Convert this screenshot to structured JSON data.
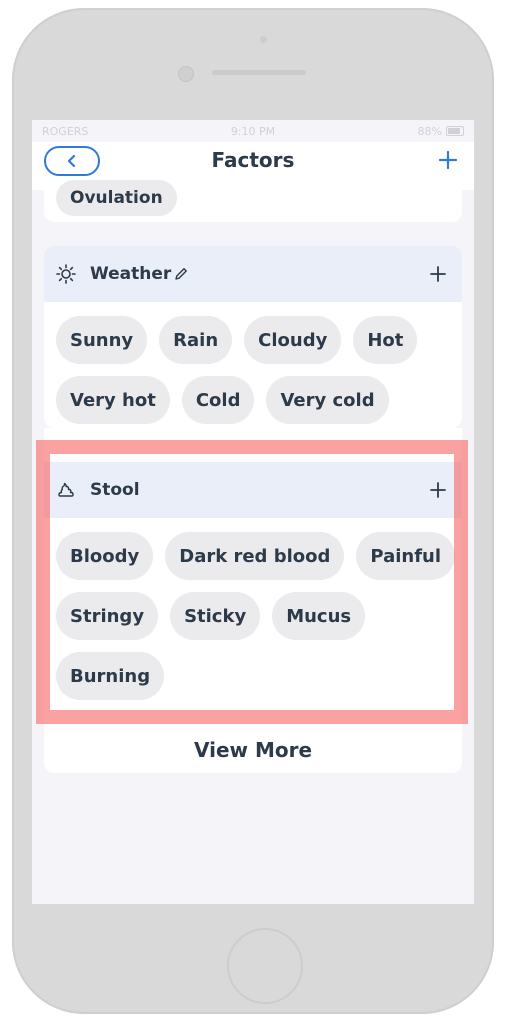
{
  "status_bar": {
    "carrier": "ROGERS",
    "time": "9:10 PM",
    "battery": "88%"
  },
  "nav": {
    "title": "Factors"
  },
  "previous_section": {
    "chip": "Ovulation"
  },
  "weather": {
    "title": "Weather",
    "chips": [
      "Sunny",
      "Rain",
      "Cloudy",
      "Hot",
      "Very hot",
      "Cold",
      "Very cold"
    ]
  },
  "stool": {
    "title": "Stool",
    "chips": [
      "Bloody",
      "Dark red blood",
      "Painful",
      "Stringy",
      "Sticky",
      "Mucus",
      "Burning"
    ]
  },
  "footer": {
    "view_more": "View More"
  },
  "colors": {
    "accent": "#2f7bd9",
    "chip_bg": "#ebebed",
    "header_bg": "#e9eef8",
    "highlight": "#f76e6e"
  }
}
